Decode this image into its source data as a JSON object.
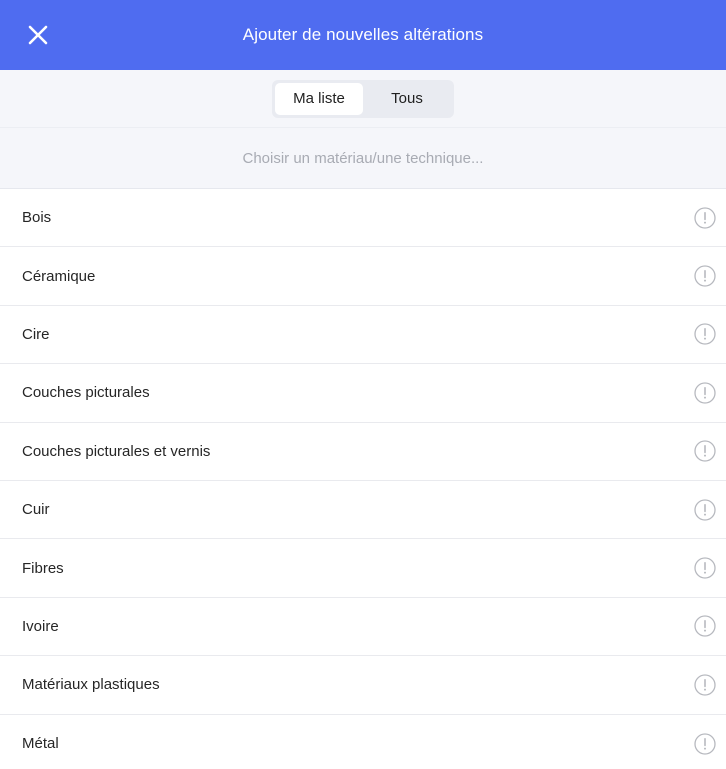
{
  "header": {
    "title": "Ajouter de nouvelles altérations",
    "close_icon": "close-icon",
    "background_color": "#4f6cf0"
  },
  "segments": {
    "items": [
      {
        "label": "Ma liste",
        "active": true
      },
      {
        "label": "Tous",
        "active": false
      }
    ]
  },
  "search": {
    "value": "",
    "placeholder": "Choisir un matériau/une technique..."
  },
  "list": {
    "item_icon": "info-icon",
    "items": [
      {
        "label": "Bois"
      },
      {
        "label": "Céramique"
      },
      {
        "label": "Cire"
      },
      {
        "label": "Couches picturales"
      },
      {
        "label": "Couches picturales et vernis"
      },
      {
        "label": "Cuir"
      },
      {
        "label": "Fibres"
      },
      {
        "label": "Ivoire"
      },
      {
        "label": "Matériaux plastiques"
      },
      {
        "label": "Métal"
      }
    ]
  }
}
